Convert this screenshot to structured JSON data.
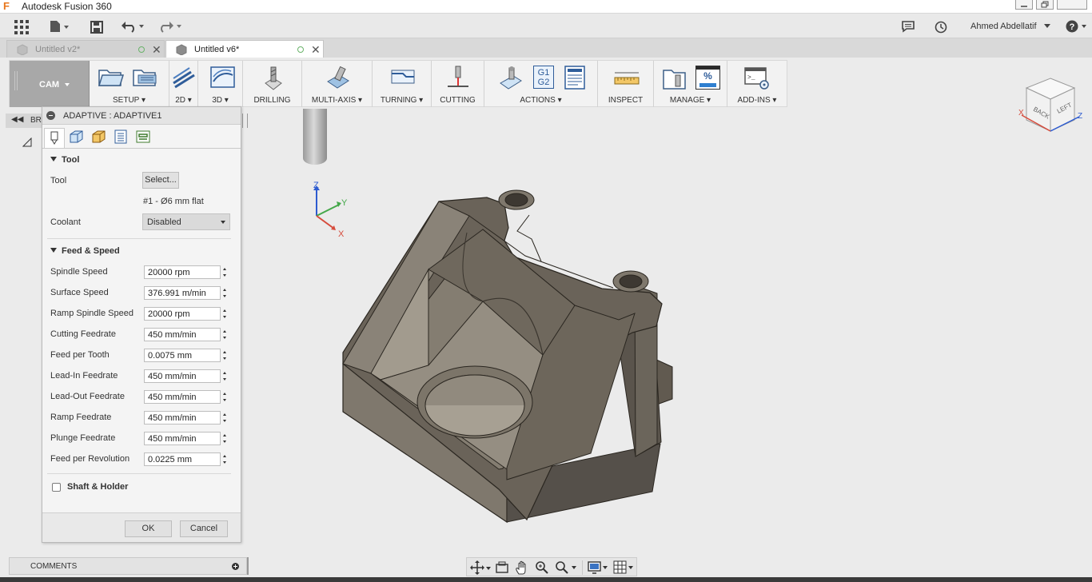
{
  "app": {
    "title": "Autodesk Fusion 360"
  },
  "topbar": {
    "user_name": "Ahmed Abdellatif",
    "icons": [
      "grid-icon",
      "file-icon",
      "save-icon",
      "undo-icon",
      "redo-icon",
      "comment-icon",
      "history-icon",
      "help-icon"
    ]
  },
  "tabs": [
    {
      "label": "Untitled v2*",
      "active": false
    },
    {
      "label": "Untitled v6*",
      "active": true
    }
  ],
  "ribbon": {
    "workspace": "CAM",
    "groups": [
      {
        "label": "SETUP ▾"
      },
      {
        "label": "2D ▾"
      },
      {
        "label": "3D ▾"
      },
      {
        "label": "DRILLING"
      },
      {
        "label": "MULTI-AXIS ▾"
      },
      {
        "label": "TURNING ▾"
      },
      {
        "label": "CUTTING"
      },
      {
        "label": "ACTIONS ▾"
      },
      {
        "label": "INSPECT"
      },
      {
        "label": "MANAGE ▾"
      },
      {
        "label": "ADD-INS ▾"
      }
    ],
    "actions_g1": "G1",
    "actions_g2": "G2",
    "manage_percent": "%"
  },
  "browser": {
    "label": "BR"
  },
  "panel": {
    "title": "ADAPTIVE : ADAPTIVE1",
    "tool_section": {
      "header": "Tool",
      "tool_label": "Tool",
      "select_button": "Select...",
      "tool_description": "#1 - Ø6 mm flat",
      "coolant_label": "Coolant",
      "coolant_value": "Disabled"
    },
    "feed_section": {
      "header": "Feed & Speed",
      "rows": [
        {
          "label": "Spindle Speed",
          "value": "20000 rpm"
        },
        {
          "label": "Surface Speed",
          "value": "376.991 m/min"
        },
        {
          "label": "Ramp Spindle Speed",
          "value": "20000 rpm"
        },
        {
          "label": "Cutting Feedrate",
          "value": "450 mm/min"
        },
        {
          "label": "Feed per Tooth",
          "value": "0.0075 mm"
        },
        {
          "label": "Lead-In Feedrate",
          "value": "450 mm/min"
        },
        {
          "label": "Lead-Out Feedrate",
          "value": "450 mm/min"
        },
        {
          "label": "Ramp Feedrate",
          "value": "450 mm/min"
        },
        {
          "label": "Plunge Feedrate",
          "value": "450 mm/min"
        },
        {
          "label": "Feed per Revolution",
          "value": "0.0225 mm"
        }
      ]
    },
    "shaft_section": {
      "header": "Shaft & Holder"
    },
    "ok_button": "OK",
    "cancel_button": "Cancel"
  },
  "comments": {
    "label": "COMMENTS"
  },
  "viewport": {
    "triad": {
      "x": "X",
      "y": "Y",
      "z": "Z"
    },
    "viewcube": {
      "back": "BACK",
      "left": "LEFT"
    },
    "axis_colors": {
      "x": "#d64b3c",
      "y": "#45a84a",
      "z": "#2d5bd0"
    }
  }
}
